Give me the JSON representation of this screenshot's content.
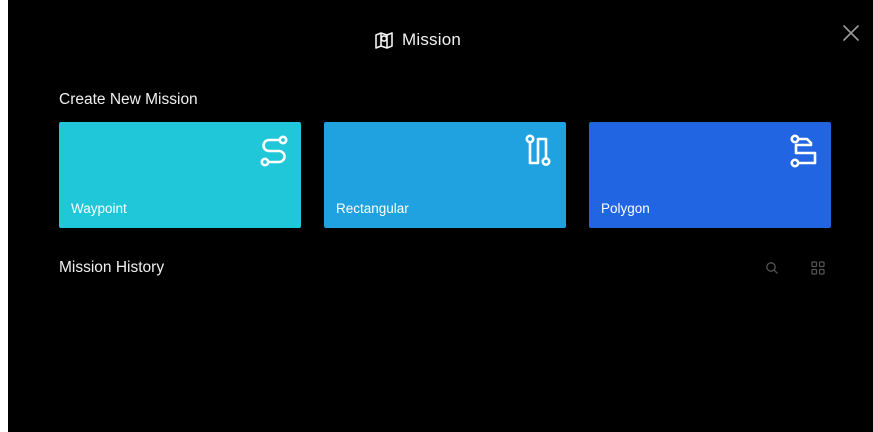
{
  "dialog": {
    "title": "Mission",
    "title_icon": "map-icon",
    "close_icon": "close-icon"
  },
  "create": {
    "heading": "Create New Mission",
    "cards": [
      {
        "label": "Waypoint",
        "icon": "waypoint-route-icon",
        "color": "#20c7d8"
      },
      {
        "label": "Rectangular",
        "icon": "rectangular-route-icon",
        "color": "#20a1e0"
      },
      {
        "label": "Polygon",
        "icon": "polygon-route-icon",
        "color": "#2265e2"
      }
    ]
  },
  "history": {
    "heading": "Mission History",
    "search_icon": "search-icon",
    "grid_icon": "grid-view-icon"
  }
}
